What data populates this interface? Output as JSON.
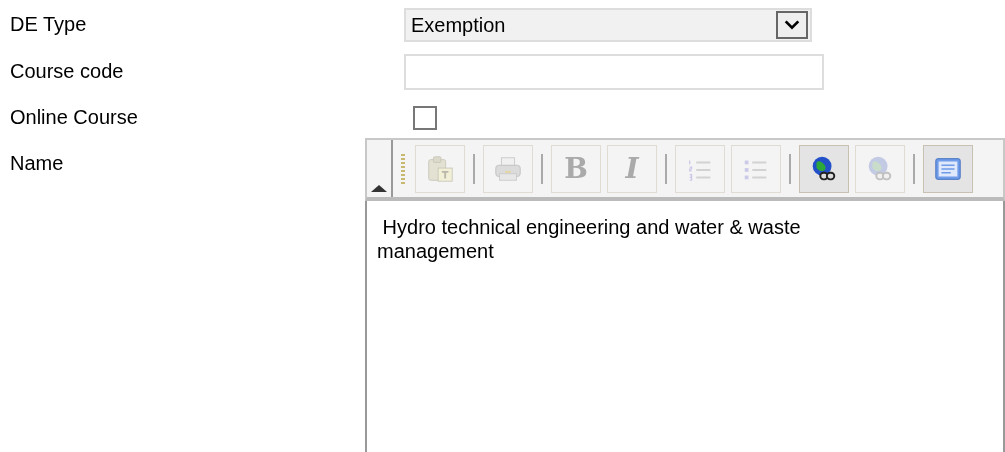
{
  "fields": [
    {
      "kind": "select",
      "label": "DE Type",
      "value": "Exemption"
    },
    {
      "kind": "text",
      "label": "Course code"
    },
    {
      "kind": "checkbox",
      "label": "Online Course",
      "checked": false
    },
    {
      "kind": "editor",
      "label": "Name",
      "toolbar": [
        {
          "kind": "paste",
          "disabled": true
        },
        {
          "kind": "separator"
        },
        {
          "kind": "print",
          "disabled": true
        },
        {
          "kind": "separator"
        },
        {
          "kind": "bold",
          "text": "B",
          "disabled": true
        },
        {
          "kind": "italic",
          "text": "I",
          "disabled": true
        },
        {
          "kind": "separator"
        },
        {
          "kind": "ordered-list",
          "disabled": true
        },
        {
          "kind": "bullet-list",
          "disabled": true
        },
        {
          "kind": "separator"
        },
        {
          "kind": "link",
          "disabled": false
        },
        {
          "kind": "unlink",
          "disabled": true
        },
        {
          "kind": "separator"
        },
        {
          "kind": "source",
          "disabled": false
        }
      ],
      "value": " Hydro technical engineering and water & waste management"
    }
  ]
}
